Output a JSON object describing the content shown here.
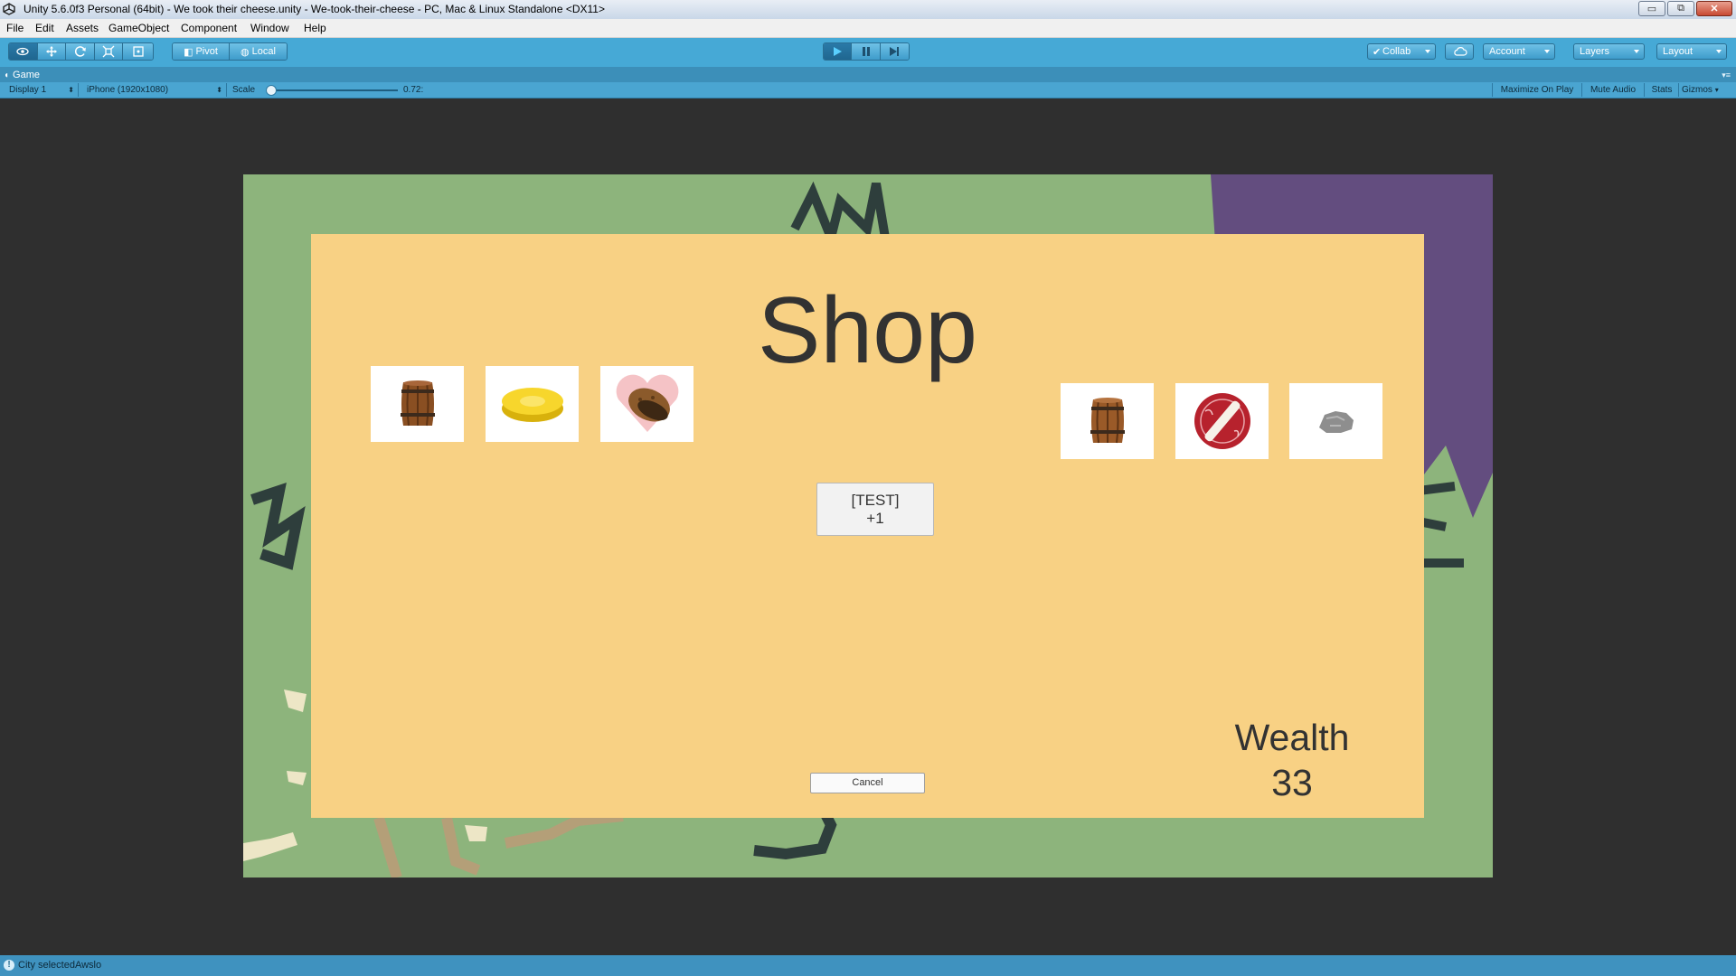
{
  "window": {
    "title": "Unity 5.6.0f3 Personal (64bit) - We took their cheese.unity - We-took-their-cheese - PC, Mac & Linux Standalone <DX11>",
    "controls": {
      "minimize": "▭",
      "restore": "⧉",
      "close": "✕"
    }
  },
  "menubar": [
    "File",
    "Edit",
    "Assets",
    "GameObject",
    "Component",
    "Window",
    "Help"
  ],
  "toolbar": {
    "pivot_label": "Pivot",
    "local_label": "Local",
    "collab_label": "Collab",
    "account_label": "Account",
    "layers_label": "Layers",
    "layout_label": "Layout",
    "play_active": true
  },
  "game_view": {
    "tab_label": "Game",
    "display_label": "Display 1",
    "resolution_label": "iPhone (1920x1080)",
    "scale_label": "Scale",
    "scale_value": "0.72:",
    "scale_fraction": 0.02,
    "maximize_label": "Maximize On Play",
    "mute_label": "Mute Audio",
    "stats_label": "Stats",
    "gizmos_label": "Gizmos"
  },
  "shop": {
    "title": "Shop",
    "left_items": [
      {
        "icon": "barrel-icon"
      },
      {
        "icon": "cheese-icon"
      },
      {
        "icon": "potato-heart-icon"
      }
    ],
    "right_items": [
      {
        "icon": "barrel-icon"
      },
      {
        "icon": "scroll-seal-icon"
      },
      {
        "icon": "rock-icon"
      }
    ],
    "test_button": {
      "line1": "[TEST]",
      "line2": "+1"
    },
    "cancel_label": "Cancel",
    "wealth_label": "Wealth",
    "wealth_value": "33"
  },
  "colors": {
    "panel": "#f8d184",
    "map_green": "#8db47c",
    "map_purple": "#634d7f",
    "unity_toolbar": "#46a9d6"
  },
  "statusbar": {
    "message": "City selectedAwslo"
  }
}
